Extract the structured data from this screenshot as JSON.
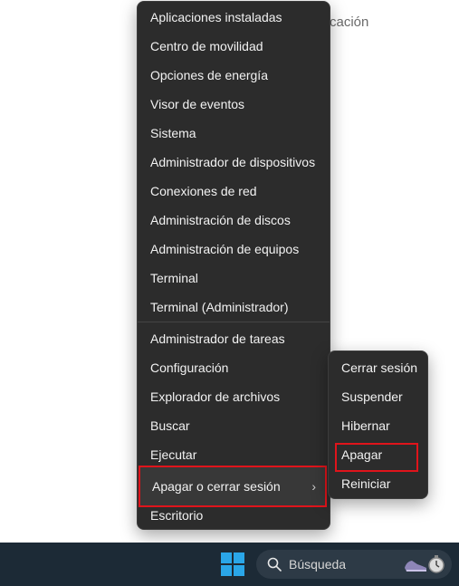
{
  "background": {
    "partial_text": "cación"
  },
  "context_menu": {
    "items": [
      {
        "label": "Aplicaciones instaladas"
      },
      {
        "label": "Centro de movilidad"
      },
      {
        "label": "Opciones de energía"
      },
      {
        "label": "Visor de eventos"
      },
      {
        "label": "Sistema"
      },
      {
        "label": "Administrador de dispositivos"
      },
      {
        "label": "Conexiones de red"
      },
      {
        "label": "Administración de discos"
      },
      {
        "label": "Administración de equipos"
      },
      {
        "label": "Terminal"
      },
      {
        "label": "Terminal (Administrador)"
      },
      {
        "label": "Administrador de tareas"
      },
      {
        "label": "Configuración"
      },
      {
        "label": "Explorador de archivos"
      },
      {
        "label": "Buscar"
      },
      {
        "label": "Ejecutar"
      },
      {
        "label": "Apagar o cerrar sesión"
      },
      {
        "label": "Escritorio"
      }
    ],
    "submenu_chevron": "›"
  },
  "submenu": {
    "items": [
      {
        "label": "Cerrar sesión"
      },
      {
        "label": "Suspender"
      },
      {
        "label": "Hibernar"
      },
      {
        "label": "Apagar"
      },
      {
        "label": "Reiniciar"
      }
    ]
  },
  "taskbar": {
    "search_placeholder": "Búsqueda",
    "start_icon": "windows-logo-icon",
    "search_icon": "search-icon",
    "widget_icon": "shoe-timer-icon"
  },
  "colors": {
    "menu_bg": "#2c2c2c",
    "menu_text": "#f2f2f2",
    "highlight_red": "#e0141b",
    "taskbar_bg": "#1c2a36",
    "windows_blue": "#2aa6e8"
  }
}
